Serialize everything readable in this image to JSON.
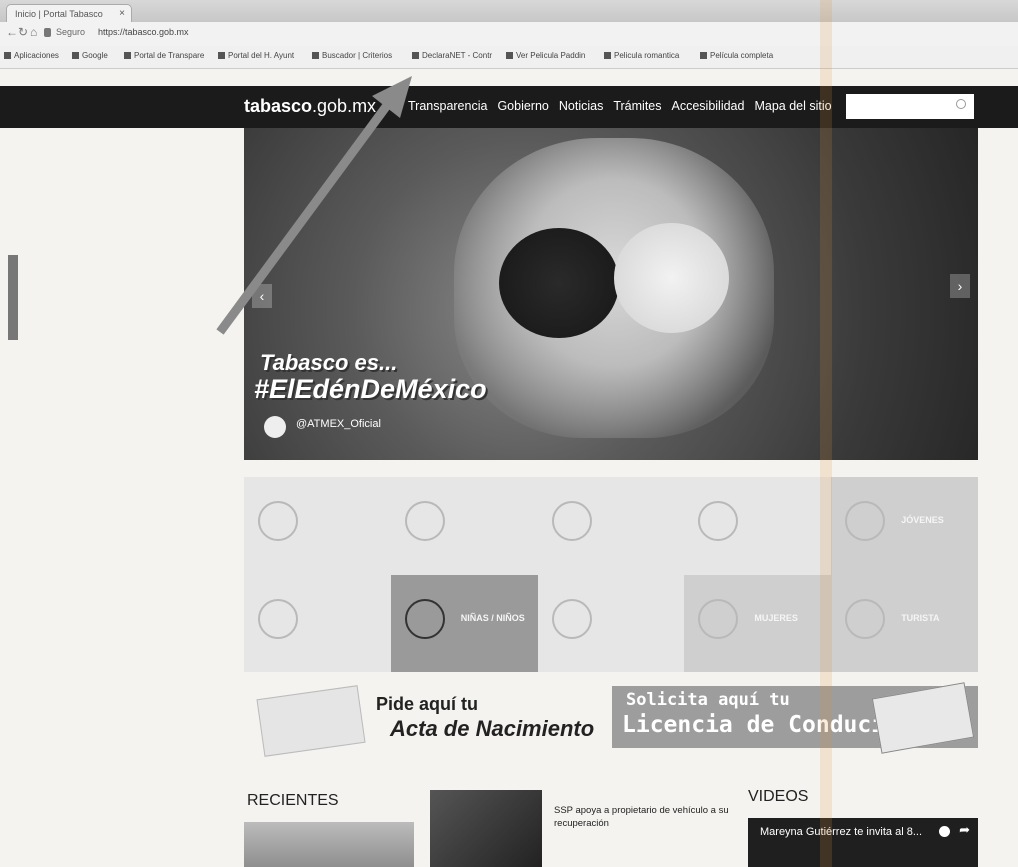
{
  "browser": {
    "tab_title": "Inicio | Portal Tabasco",
    "tab_close": "×",
    "secure_label": "Seguro",
    "url": "https://tabasco.gob.mx",
    "bookmarks": [
      "Aplicaciones",
      "Google",
      "Portal de Transpare",
      "Portal del H. Ayunt",
      "Buscador | Criterios",
      "DeclaraNET - Contr",
      "Ver Pelicula Paddin",
      "Pelicula romantica",
      "Película completa"
    ]
  },
  "site": {
    "logo_bold": "tabasco",
    "logo_rest": ".gob.mx",
    "nav": [
      "Transparencia",
      "Gobierno",
      "Noticias",
      "Trámites",
      "Accesibilidad",
      "Mapa del sitio"
    ],
    "search_placeholder": ""
  },
  "hero": {
    "line1": "Tabasco es...",
    "line2": "#ElEdénDeMéxico",
    "handle": "@ATMEX_Oficial",
    "prev": "‹",
    "next": "›"
  },
  "tiles": [
    {
      "label": "",
      "tone": "light",
      "icon": "people-icon"
    },
    {
      "label": "",
      "tone": "light",
      "icon": "elderly-icon"
    },
    {
      "label": "",
      "tone": "light",
      "icon": "glasses-icon"
    },
    {
      "label": "",
      "tone": "light",
      "icon": "food-icon"
    },
    {
      "label": "JÓVENES",
      "tone": "mid",
      "icon": "headphones-icon"
    },
    {
      "label": "",
      "tone": "light",
      "icon": "person-icon"
    },
    {
      "label": "NIÑAS / NIÑOS",
      "tone": "dark",
      "icon": "ball-icon"
    },
    {
      "label": "",
      "tone": "light",
      "icon": "worker-icon"
    },
    {
      "label": "MUJERES",
      "tone": "mid",
      "icon": "earrings-icon"
    },
    {
      "label": "TURISTA",
      "tone": "mid",
      "icon": "umbrella-icon"
    }
  ],
  "banners": {
    "birth_line1": "Pide aquí tu",
    "birth_line2": "Acta de Nacimiento",
    "license_line1": "Solicita aquí tu",
    "license_line2": "Licencia de Conducir"
  },
  "bottom": {
    "recent_heading": "RECIENTES",
    "news_title": "SSP apoya a propietario de vehículo a su recuperación",
    "videos_heading": "VIDEOS",
    "video_title": "Mareyna Gutiérrez te invita al 8..."
  },
  "colors": {
    "header_bg": "#1b1b1b",
    "tile_dark": "#9a9a9a"
  }
}
